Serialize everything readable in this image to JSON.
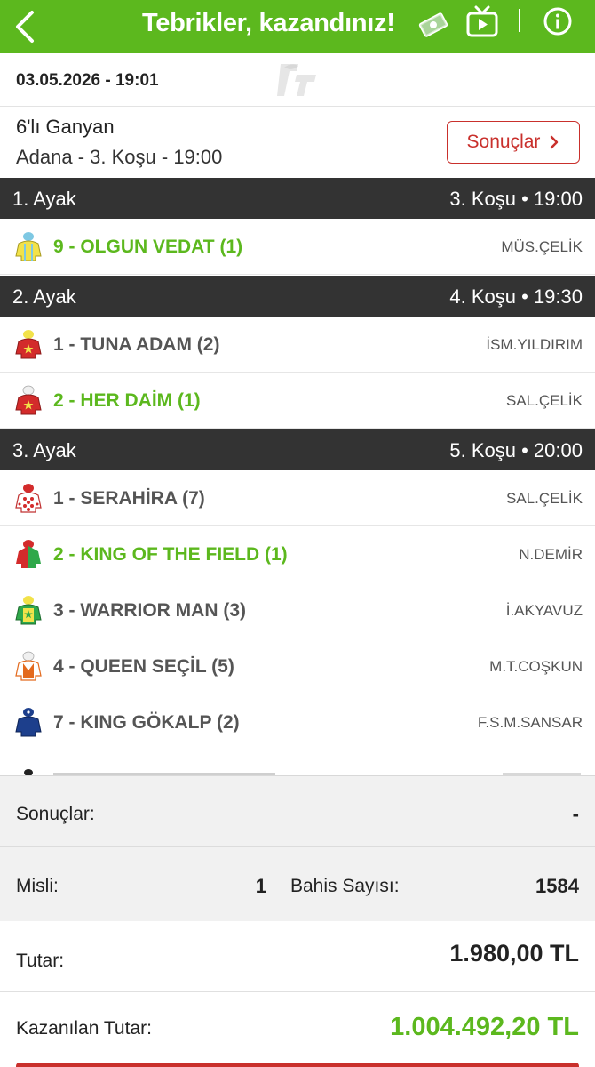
{
  "header": {
    "title": "Tebrikler, kazandınız!",
    "colors": {
      "primary": "#5cb81e",
      "leg_header": "#333333",
      "accent_red": "#c9302c"
    },
    "icons": [
      "back-icon",
      "money-icon",
      "tv-icon",
      "info-icon"
    ]
  },
  "ticket": {
    "datetime": "03.05.2026 - 19:01",
    "bet_type": "6'lı Ganyan",
    "race_info": "Adana - 3. Koşu - 19:00",
    "results_button": "Sonuçlar"
  },
  "legs": [
    {
      "label": "1. Ayak",
      "race": "3. Koşu • 19:00",
      "horses": [
        {
          "name": "9 - OLGUN VEDAT (1)",
          "jockey": "MÜS.ÇELİK",
          "winner": true
        }
      ]
    },
    {
      "label": "2. Ayak",
      "race": "4. Koşu • 19:30",
      "horses": [
        {
          "name": "1 - TUNA ADAM (2)",
          "jockey": "İSM.YILDIRIM",
          "winner": false
        },
        {
          "name": "2 - HER DAİM (1)",
          "jockey": "SAL.ÇELİK",
          "winner": true
        }
      ]
    },
    {
      "label": "3. Ayak",
      "race": "5. Koşu • 20:00",
      "horses": [
        {
          "name": "1 - SERAHİRA (7)",
          "jockey": "SAL.ÇELİK",
          "winner": false
        },
        {
          "name": "2 - KING OF THE FIELD (1)",
          "jockey": "N.DEMİR",
          "winner": true
        },
        {
          "name": "3 - WARRIOR MAN (3)",
          "jockey": "İ.AKYAVUZ",
          "winner": false
        },
        {
          "name": "4 - QUEEN SEÇİL (5)",
          "jockey": "M.T.COŞKUN",
          "winner": false
        },
        {
          "name": "7 - KING GÖKALP (2)",
          "jockey": "F.S.M.SANSAR",
          "winner": false
        }
      ]
    }
  ],
  "summary": {
    "results_label": "Sonuçlar:",
    "results_value": "-",
    "multiplier_label": "Misli:",
    "multiplier_value": "1",
    "bet_count_label": "Bahis Sayısı:",
    "bet_count_value": "1584",
    "amount_label": "Tutar:",
    "amount_value": "1.980,00 TL",
    "won_label": "Kazanılan Tutar:",
    "won_value": "1.004.492,20 TL"
  }
}
